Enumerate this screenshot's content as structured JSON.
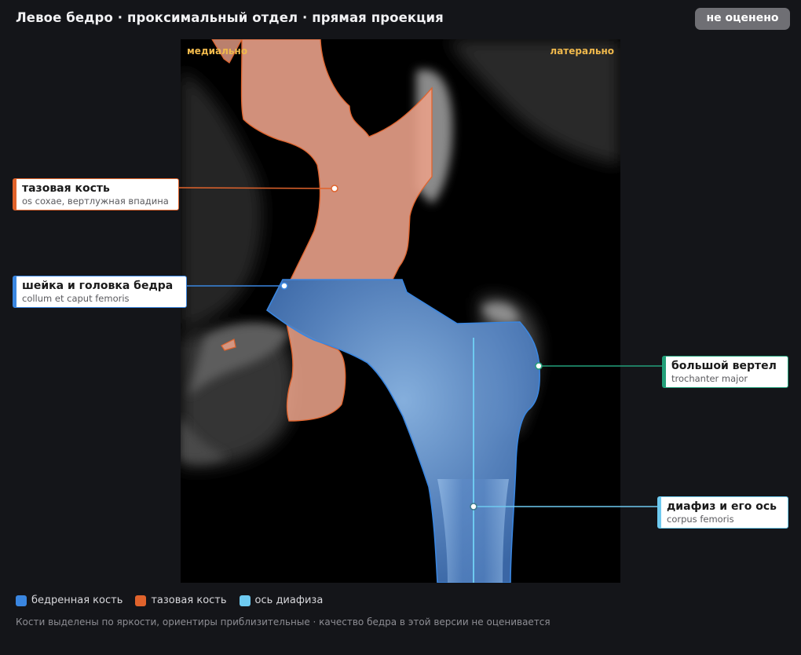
{
  "header": {
    "title": "Левое бедро · проксимальный отдел · прямая проекция",
    "status_badge": "не оценено"
  },
  "viewport": {
    "orientation_left": "медиально",
    "orientation_right": "латерально"
  },
  "callouts": [
    {
      "id": "pelvis",
      "name": "тазовая кость",
      "latin": "os coxae, вертлужная впадина",
      "color": "#e0632c"
    },
    {
      "id": "neck",
      "name": "шейка и головка бедра",
      "latin": "collum et caput femoris",
      "color": "#3a86e0"
    },
    {
      "id": "trochanter",
      "name": "большой вертел",
      "latin": "trochanter major",
      "color": "#23a07a"
    },
    {
      "id": "shaft",
      "name": "диафиз и его ось",
      "latin": "corpus femoris",
      "color": "#6ecaf0"
    }
  ],
  "legend": [
    {
      "label": "бедренная кость",
      "color": "#3a86e0"
    },
    {
      "label": "тазовая кость",
      "color": "#e0632c"
    },
    {
      "label": "ось диафиза",
      "color": "#6ecaf0"
    }
  ],
  "footnote": "Кости выделены по яркости, ориентиры приблизительные · качество бедра в этой версии не оценивается"
}
